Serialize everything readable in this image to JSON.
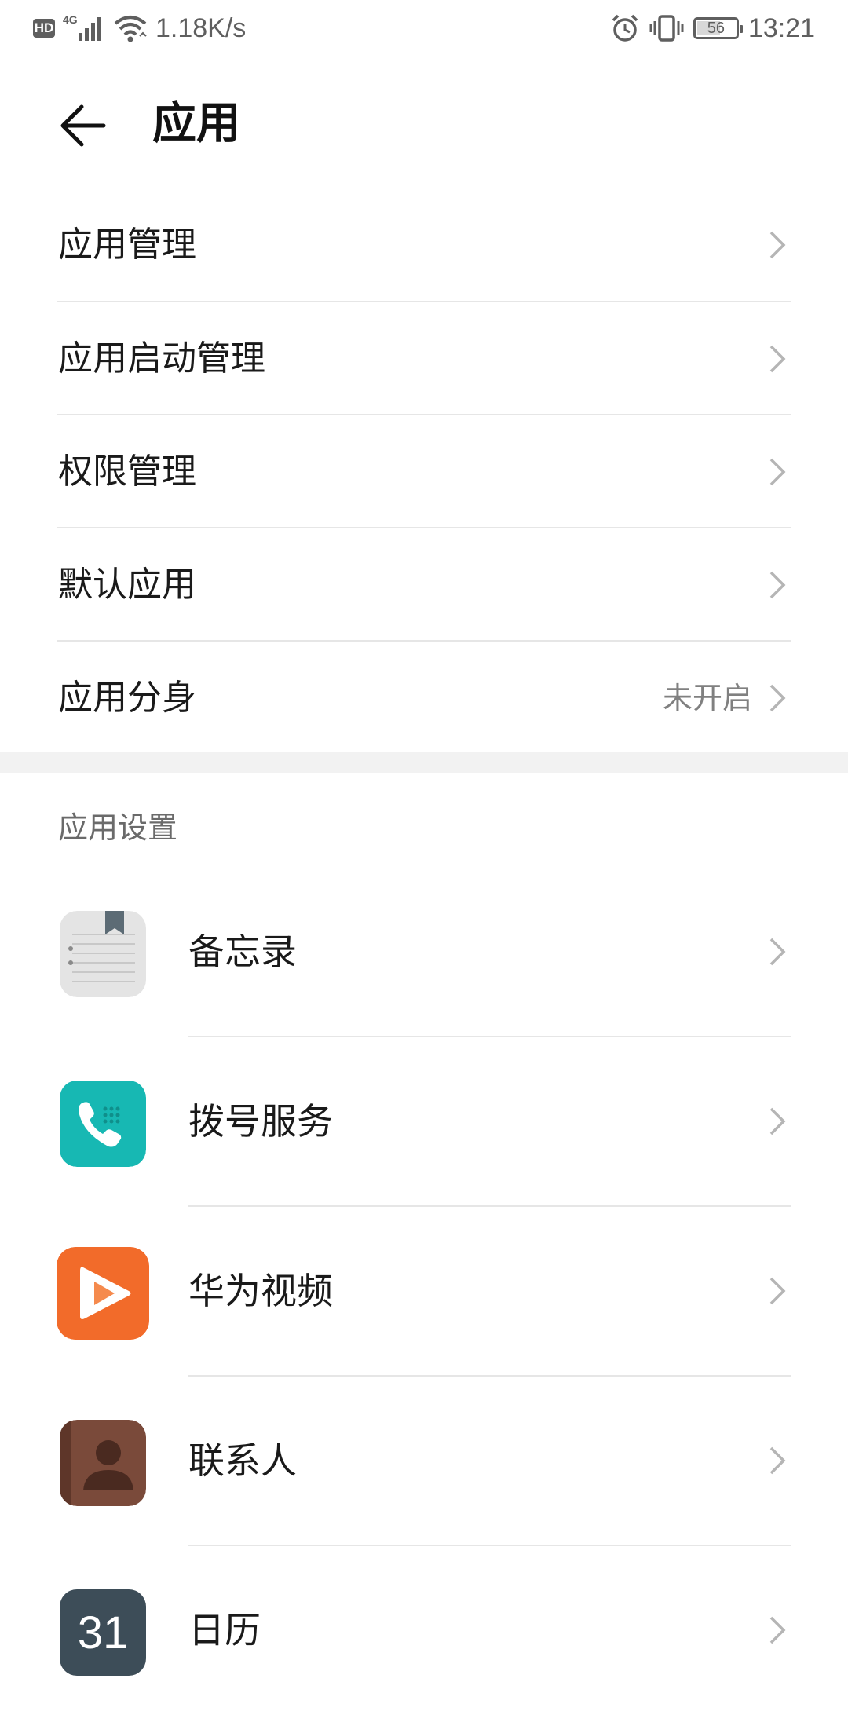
{
  "status_bar": {
    "hd": "HD",
    "network": "4G",
    "speed": "1.18K/s",
    "battery": "56",
    "time": "13:21"
  },
  "header": {
    "title": "应用",
    "back_icon": "arrow-left-icon"
  },
  "menu": [
    {
      "label": "应用管理",
      "value": ""
    },
    {
      "label": "应用启动管理",
      "value": ""
    },
    {
      "label": "权限管理",
      "value": ""
    },
    {
      "label": "默认应用",
      "value": ""
    },
    {
      "label": "应用分身",
      "value": "未开启"
    }
  ],
  "app_settings": {
    "title": "应用设置",
    "apps": [
      {
        "label": "备忘录",
        "icon": "notepad-icon"
      },
      {
        "label": "拨号服务",
        "icon": "phone-icon"
      },
      {
        "label": "华为视频",
        "icon": "play-icon"
      },
      {
        "label": "联系人",
        "icon": "contact-icon"
      },
      {
        "label": "日历",
        "icon": "calendar-icon",
        "icon_text": "31"
      }
    ]
  },
  "colors": {
    "accent_teal": "#17b8b3",
    "video_orange": "#f26b2a",
    "contact_brown": "#7a4a3a",
    "calendar_slate": "#3d4d58"
  }
}
